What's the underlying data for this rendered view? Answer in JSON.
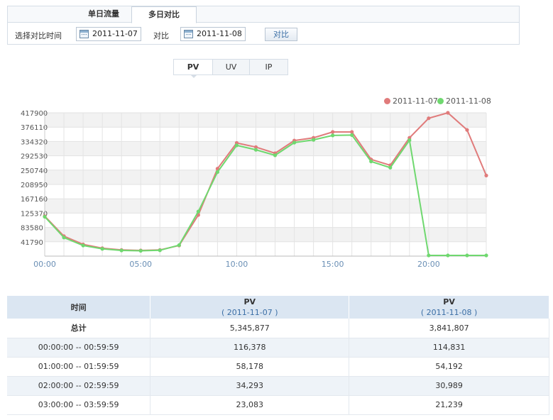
{
  "tabs": {
    "single_day": "单日流量",
    "multi_day": "多日对比"
  },
  "filter": {
    "label": "选择对比时间",
    "date1": "2011-11-07",
    "vs_label": "对比",
    "date2": "2011-11-08",
    "compare_button": "对比"
  },
  "metric_tabs": [
    "PV",
    "UV",
    "IP"
  ],
  "colors": {
    "series1": "#e07b7b",
    "series2": "#6fd86f",
    "accent": "#3a6ea5"
  },
  "chart_data": {
    "type": "line",
    "x": [
      "00:00",
      "01:00",
      "02:00",
      "03:00",
      "04:00",
      "05:00",
      "06:00",
      "07:00",
      "08:00",
      "09:00",
      "10:00",
      "11:00",
      "12:00",
      "13:00",
      "14:00",
      "15:00",
      "16:00",
      "17:00",
      "18:00",
      "19:00",
      "20:00",
      "21:00",
      "22:00",
      "23:00"
    ],
    "x_tick_labels": [
      "00:00",
      "05:00",
      "10:00",
      "15:00",
      "20:00"
    ],
    "y_tick_labels": [
      "417900",
      "376110",
      "334320",
      "292530",
      "250740",
      "208950",
      "167160",
      "125370",
      "83580",
      "41790"
    ],
    "ylim": [
      0,
      417900
    ],
    "grid": true,
    "legend_position": "top-right",
    "series": [
      {
        "name": "2011-11-07",
        "values": [
          116378,
          58178,
          34293,
          23083,
          18000,
          16500,
          18000,
          31000,
          120000,
          255000,
          330000,
          318000,
          300000,
          337000,
          345000,
          362000,
          362000,
          282000,
          265000,
          345000,
          402000,
          417900,
          368000,
          235000
        ]
      },
      {
        "name": "2011-11-08",
        "values": [
          114831,
          54192,
          30989,
          21239,
          16500,
          15500,
          17000,
          32000,
          130000,
          245000,
          323000,
          310000,
          294000,
          331000,
          339000,
          352000,
          353000,
          276000,
          258000,
          338000,
          2000,
          2000,
          2000,
          2000
        ]
      }
    ]
  },
  "table": {
    "headers": [
      {
        "title": "时间",
        "sub": ""
      },
      {
        "title": "PV",
        "sub": "( 2011-11-07 )"
      },
      {
        "title": "PV",
        "sub": "( 2011-11-08 )"
      }
    ],
    "rows": [
      [
        "总计",
        "5,345,877",
        "3,841,807"
      ],
      [
        "00:00:00 -- 00:59:59",
        "116,378",
        "114,831"
      ],
      [
        "01:00:00 -- 01:59:59",
        "58,178",
        "54,192"
      ],
      [
        "02:00:00 -- 02:59:59",
        "34,293",
        "30,989"
      ],
      [
        "03:00:00 -- 03:59:59",
        "23,083",
        "21,239"
      ]
    ]
  }
}
